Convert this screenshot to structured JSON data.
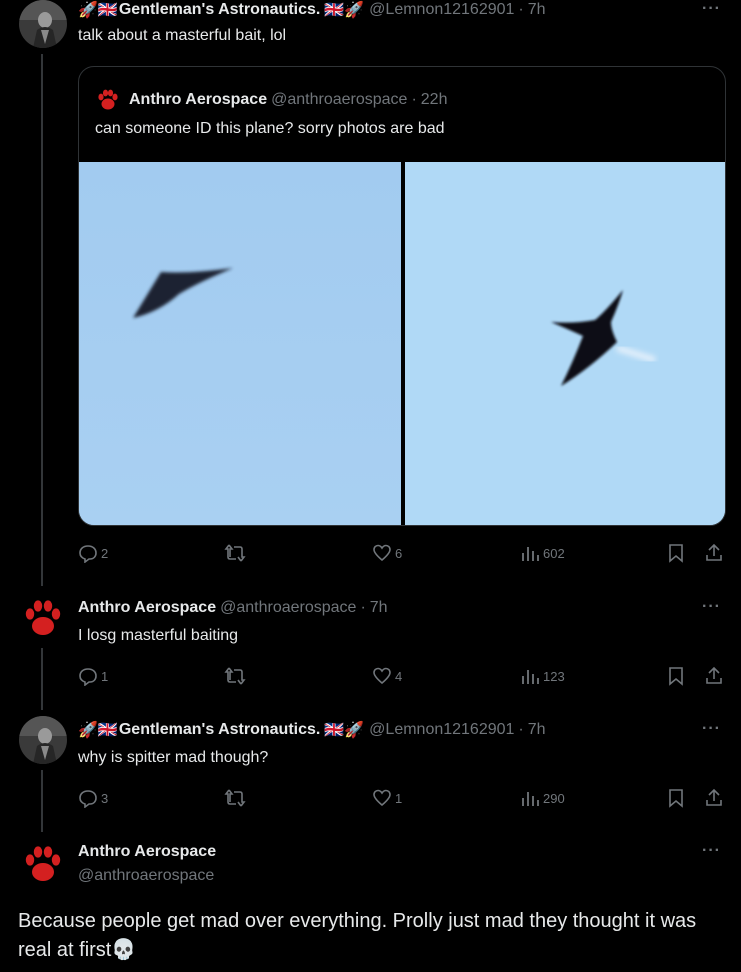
{
  "colors": {
    "background": "#000000",
    "text": "#e7e9ea",
    "muted": "#71767b",
    "border": "#2f3336",
    "paw_red": "#d42020",
    "sky_left": "#a4cdf1",
    "sky_right": "#b0d9f6"
  },
  "main_tweet": {
    "prefix_emoji": "🚀🇬🇧",
    "name": "Gentleman's Astronautics.",
    "suffix_emoji": "🇬🇧🚀",
    "handle": "@Lemnon12162901",
    "dot": "·",
    "time": "7h",
    "more": "···",
    "text": "talk about a masterful bait, lol",
    "quote": {
      "name": "Anthro Aerospace",
      "handle": "@anthroaerospace",
      "dot": "·",
      "time": "22h",
      "text": "can someone ID this plane? sorry photos are bad",
      "photos": [
        "blurry-dark-craft-left",
        "blurry-dark-craft-right"
      ]
    },
    "stats": {
      "replies": "2",
      "reposts": "",
      "likes": "6",
      "views": "602"
    }
  },
  "reply_1": {
    "name": "Anthro Aerospace",
    "handle": "@anthroaerospace",
    "dot": "·",
    "time": "7h",
    "more": "···",
    "text": "I losg masterful baiting",
    "stats": {
      "replies": "1",
      "reposts": "",
      "likes": "4",
      "views": "123"
    }
  },
  "reply_2": {
    "prefix_emoji": "🚀🇬🇧",
    "name": "Gentleman's Astronautics.",
    "suffix_emoji": "🇬🇧🚀",
    "handle": "@Lemnon12162901",
    "dot": "·",
    "time": "7h",
    "more": "···",
    "text": "why is spitter mad though?",
    "stats": {
      "replies": "3",
      "reposts": "",
      "likes": "1",
      "views": "290"
    }
  },
  "focused_tweet": {
    "name": "Anthro Aerospace",
    "handle": "@anthroaerospace",
    "more": "···",
    "text": "Because people get mad over everything. Prolly just mad they thought it was real at first",
    "end_emoji": "💀"
  }
}
